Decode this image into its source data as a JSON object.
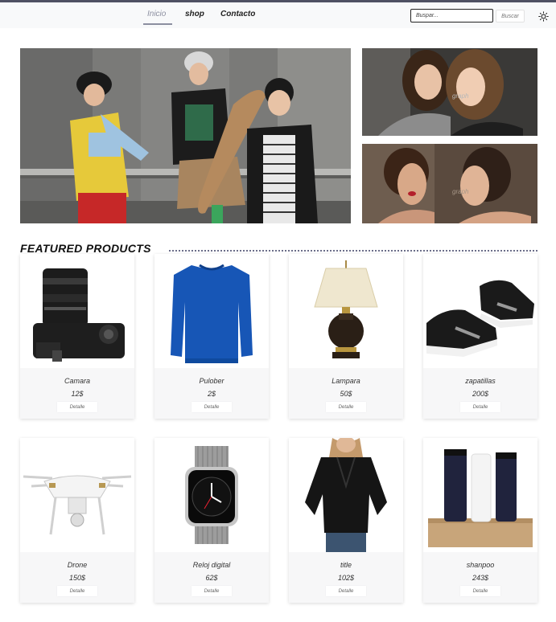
{
  "nav": {
    "links": [
      "Inicio",
      "shop",
      "Contacto"
    ],
    "search_placeholder": "Buspar...",
    "search_button": "Buscar",
    "theme_icon": "sun-icon"
  },
  "carousel": {
    "watermark_1": "graph",
    "watermark_2": "graph"
  },
  "section_title": "FEATURED PRODUCTS",
  "products": [
    {
      "name": "Camara",
      "price": "12$",
      "detail": "Detalle"
    },
    {
      "name": "Pulober",
      "price": "2$",
      "detail": "Detalle"
    },
    {
      "name": "Lampara",
      "price": "50$",
      "detail": "Detalle"
    },
    {
      "name": "zapatillas",
      "price": "200$",
      "detail": "Detalle"
    },
    {
      "name": "Drone",
      "price": "150$",
      "detail": "Detalle"
    },
    {
      "name": "Reloj digital",
      "price": "62$",
      "detail": "Detalle"
    },
    {
      "name": "title",
      "price": "102$",
      "detail": "Detalle"
    },
    {
      "name": "shanpoo",
      "price": "243$",
      "detail": "Detalle"
    }
  ]
}
